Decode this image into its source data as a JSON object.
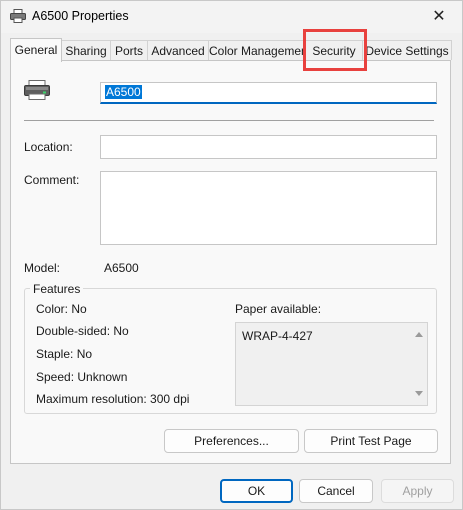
{
  "window": {
    "title": "A6500 Properties",
    "close_label": "✕"
  },
  "tabs": [
    "General",
    "Sharing",
    "Ports",
    "Advanced",
    "Color Management",
    "Security",
    "Device Settings"
  ],
  "general": {
    "printer_name": "A6500",
    "location_label": "Location:",
    "location_value": "",
    "comment_label": "Comment:",
    "comment_value": "",
    "model_label": "Model:",
    "model_value": "A6500"
  },
  "features": {
    "legend": "Features",
    "color": "Color: No",
    "double_sided": "Double-sided: No",
    "staple": "Staple: No",
    "speed": "Speed: Unknown",
    "max_resolution": "Maximum resolution: 300 dpi",
    "paper_label": "Paper available:",
    "paper_items": [
      "WRAP-4-427"
    ]
  },
  "buttons": {
    "preferences": "Preferences...",
    "print_test": "Print Test Page",
    "ok": "OK",
    "cancel": "Cancel",
    "apply": "Apply"
  },
  "colors": {
    "accent": "#0067c0",
    "highlight": "#e8413e"
  }
}
